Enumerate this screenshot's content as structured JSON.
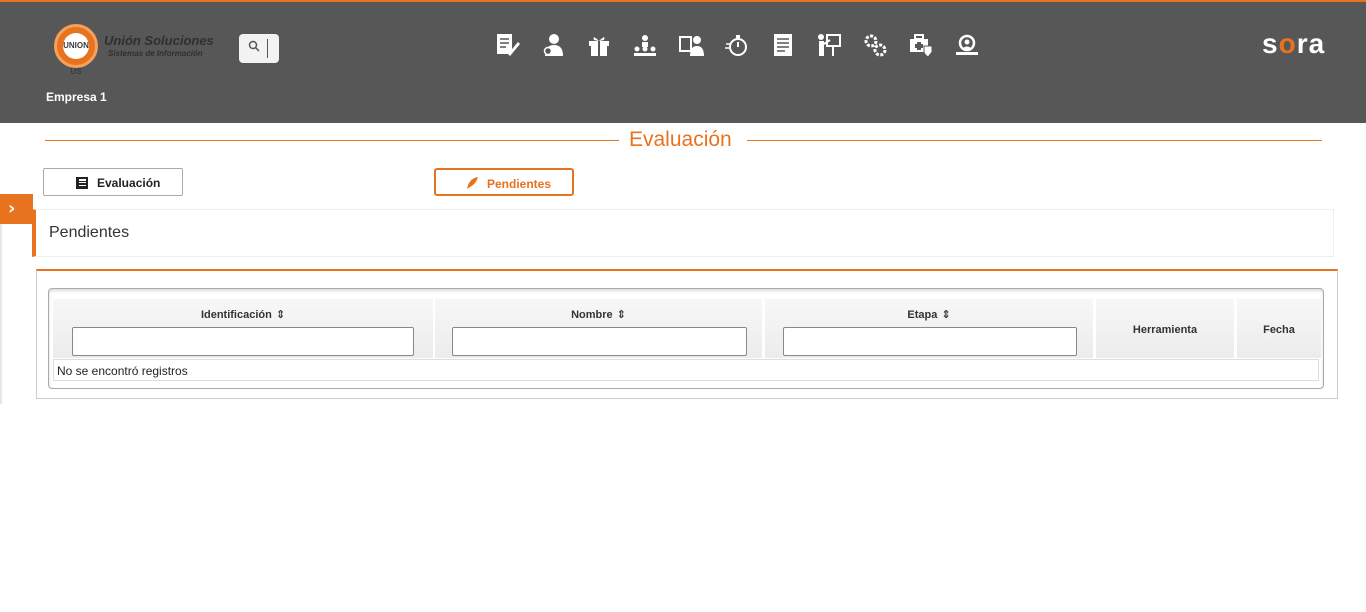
{
  "header": {
    "logo_mark": "UNION US",
    "logo_name": "Unión Soluciones",
    "logo_tagline": "Sistemas de Información",
    "brand": {
      "s": "s",
      "o": "o",
      "ra": "ra"
    },
    "company": "Empresa 1",
    "search_icon": "search-icon",
    "nav_icons": [
      "document-edit-icon",
      "user-profile-icon",
      "gift-icon",
      "org-chart-icon",
      "user-card-icon",
      "stopwatch-icon",
      "report-icon",
      "training-icon",
      "gears-icon",
      "medical-case-icon",
      "inspection-icon"
    ]
  },
  "page": {
    "title": "Evaluación"
  },
  "buttons": {
    "evaluacion_label": "Evaluación",
    "pendientes_label": "Pendientes"
  },
  "panel": {
    "heading": "Pendientes"
  },
  "table": {
    "columns": [
      {
        "label": "Identificación",
        "sortable": true,
        "filter": ""
      },
      {
        "label": "Nombre",
        "sortable": true,
        "filter": ""
      },
      {
        "label": "Etapa",
        "sortable": true,
        "filter": ""
      },
      {
        "label": "Herramienta",
        "sortable": false
      },
      {
        "label": "Fecha",
        "sortable": false
      }
    ],
    "sort_glyph": "⇕",
    "empty_message": "No se encontró registros"
  },
  "colors": {
    "accent": "#e8731f",
    "topbar": "#575757"
  }
}
